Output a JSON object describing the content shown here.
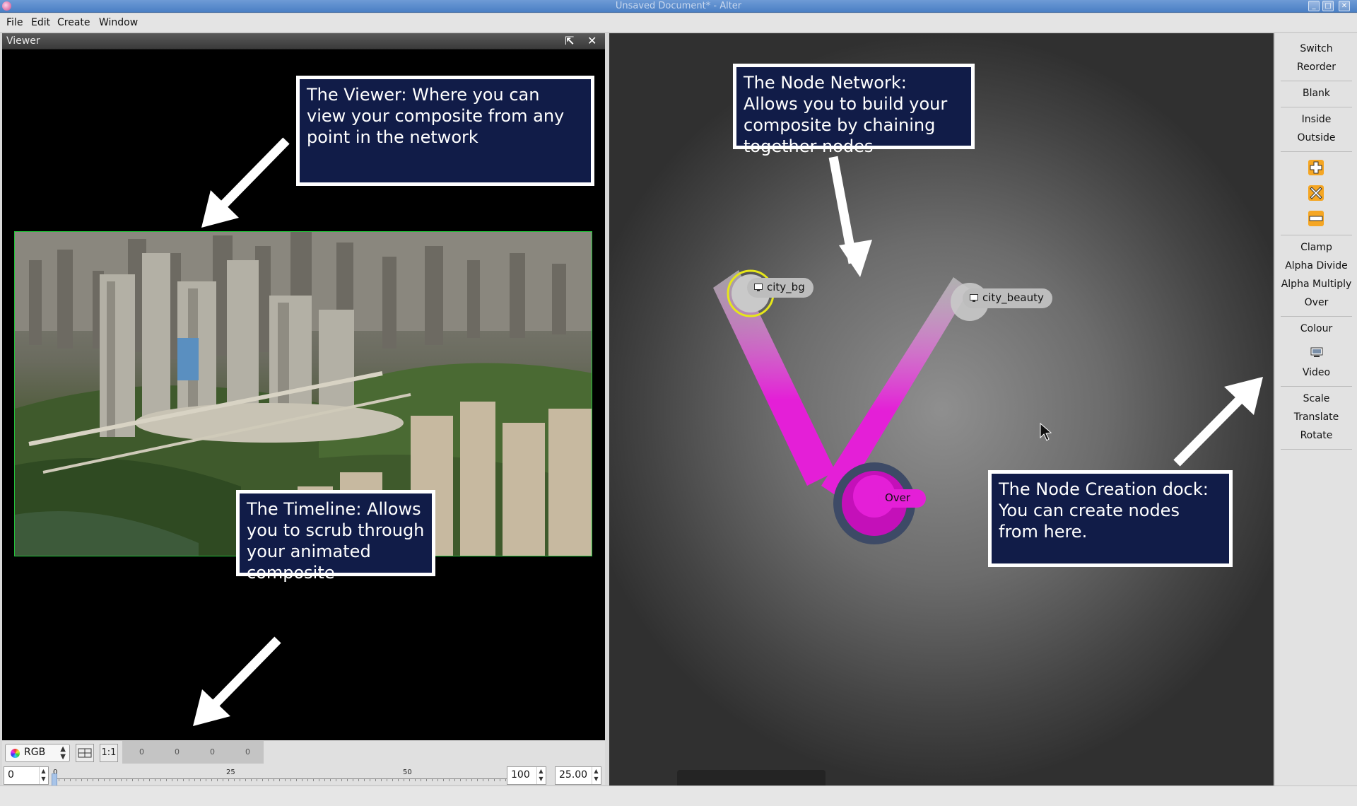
{
  "window": {
    "title": "Unsaved Document* - Alter"
  },
  "menu": {
    "file": "File",
    "edit": "Edit",
    "create": "Create",
    "window": "Window"
  },
  "viewer": {
    "title": "Viewer",
    "callout": "The Viewer:  Where you can view your composite from any point in the network",
    "timeline_callout": "The Timeline:  Allows you to scrub through your animated composite"
  },
  "controls": {
    "channel": "RGB",
    "zoom_label": "1:1",
    "pixel_values": [
      "0",
      "0",
      "0",
      "0"
    ],
    "frame": "0",
    "end_frame": "100",
    "fps": "25.00",
    "timeline_ticks": [
      "0",
      "25",
      "50"
    ]
  },
  "network": {
    "callout": "The Node Network: Allows you to build your composite by chaining together nodes",
    "dock_callout": "The Node Creation dock: You can create nodes from here.",
    "nodes": {
      "city_bg": "city_bg",
      "city_beauty": "city_beauty",
      "over": "Over"
    }
  },
  "dock": {
    "switch": "Switch",
    "reorder": "Reorder",
    "blank": "Blank",
    "inside": "Inside",
    "outside": "Outside",
    "clamp": "Clamp",
    "alpha_divide": "Alpha Divide",
    "alpha_multiply": "Alpha Multiply",
    "over": "Over",
    "colour": "Colour",
    "video": "Video",
    "scale": "Scale",
    "translate": "Translate",
    "rotate": "Rotate"
  },
  "colors": {
    "callout_bg": "#111c48",
    "edge_magenta": "#e41fd7",
    "selected_ring": "#e6e61a",
    "dock_icon_orange": "#f5a623"
  }
}
